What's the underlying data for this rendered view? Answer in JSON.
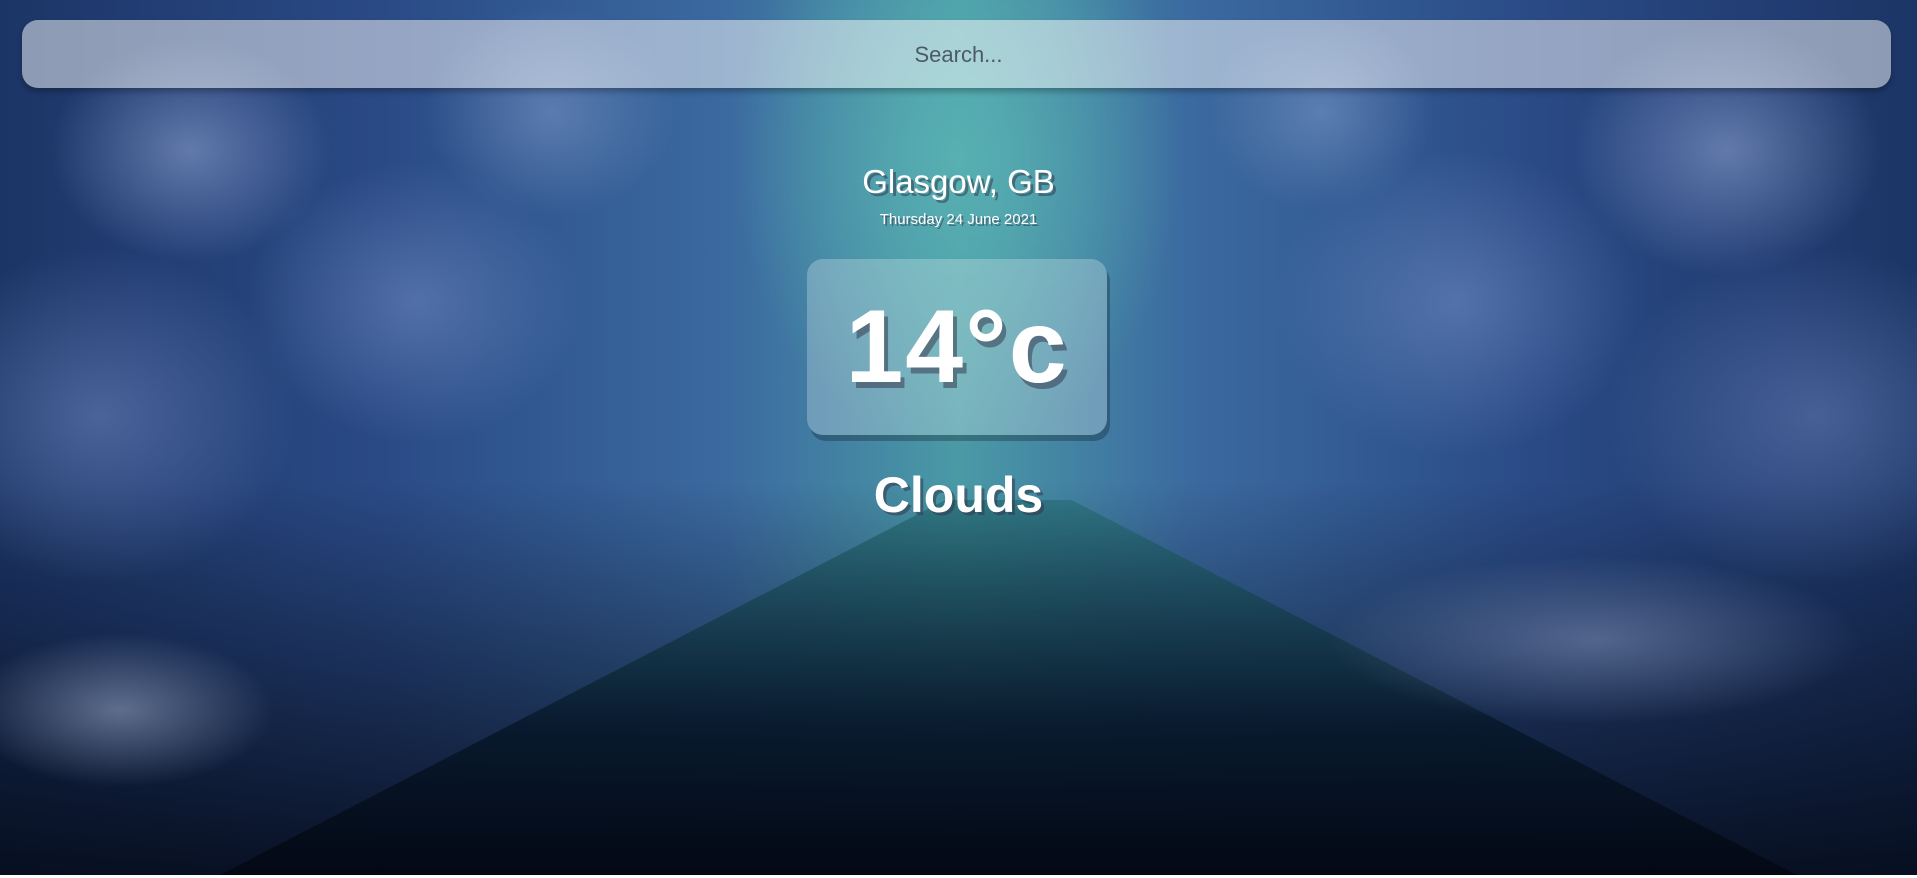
{
  "search": {
    "placeholder": "Search...",
    "value": ""
  },
  "location": {
    "city_country": "Glasgow, GB",
    "date": "Thursday 24 June 2021"
  },
  "weather": {
    "temperature": "14°c",
    "condition": "Clouds"
  },
  "colors": {
    "text": "#ffffff",
    "search_bg": "rgba(255,255,255,0.5)",
    "temp_box_bg": "rgba(255,255,255,0.25)"
  }
}
